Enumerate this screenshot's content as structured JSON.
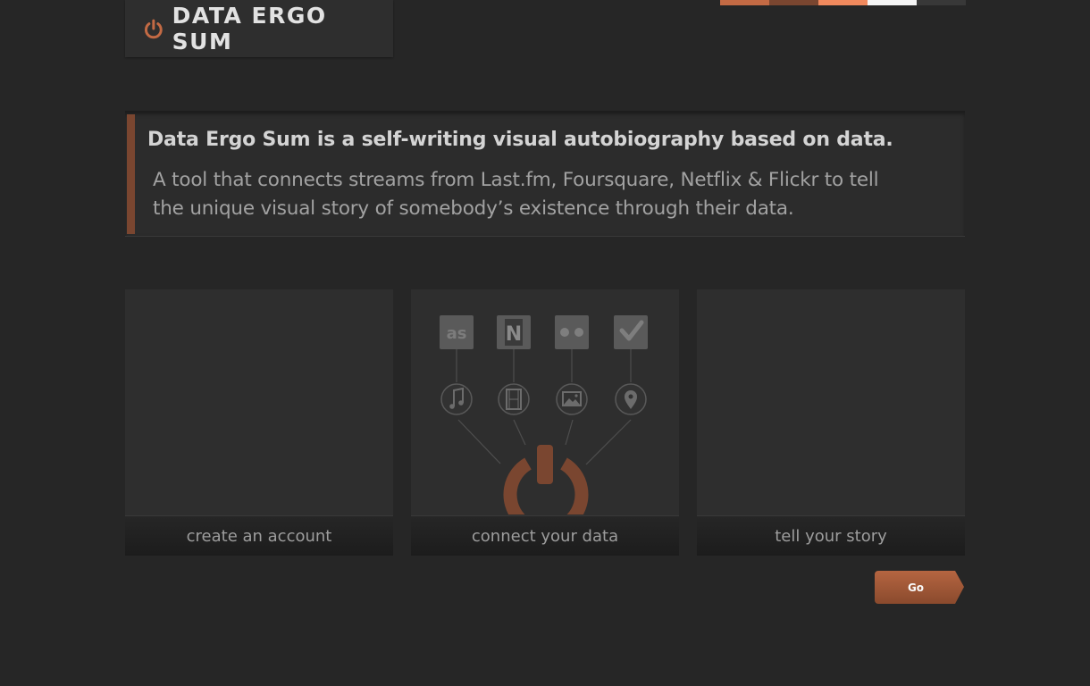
{
  "brand": {
    "name": "DATA ERGO SUM",
    "accent": "#c36a44",
    "swatches": [
      "#c36a44",
      "#7a4630",
      "#f0895d",
      "#f4f4f4",
      "#383838"
    ]
  },
  "intro": {
    "headline": "Data Ergo Sum is a self-writing visual autobiography based on data.",
    "description": "A tool that connects streams from Last.fm, Foursquare, Netflix & Flickr to tell the unique visual story of somebody’s existence through their data."
  },
  "steps": [
    {
      "label": "create an account"
    },
    {
      "label": "connect your data",
      "services": [
        "lastfm-icon",
        "netflix-icon",
        "flickr-icon",
        "foursquare-icon"
      ],
      "media": [
        "music-icon",
        "film-icon",
        "image-icon",
        "location-pin-icon"
      ]
    },
    {
      "label": "tell your story"
    }
  ],
  "actions": {
    "go_label": "Go"
  }
}
